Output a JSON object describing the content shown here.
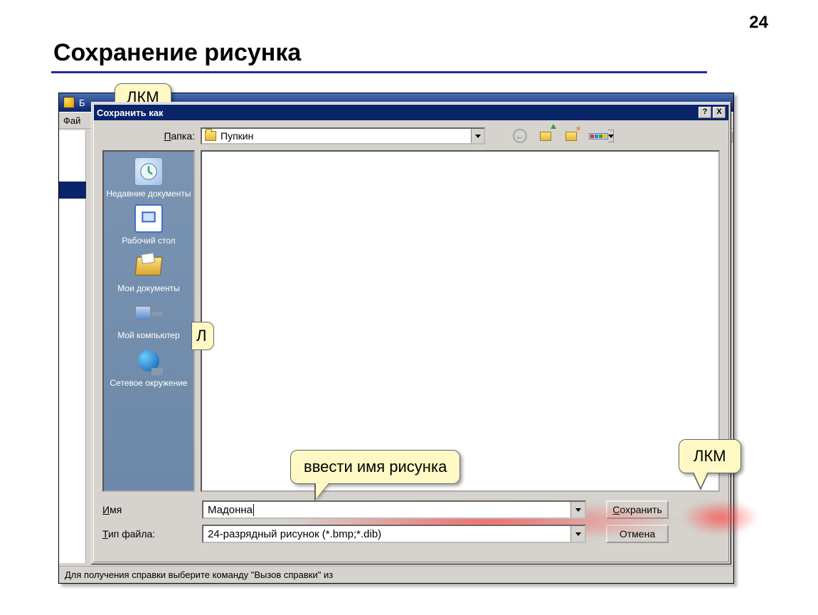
{
  "page": {
    "number": "24",
    "title": "Сохранение рисунка"
  },
  "back_window": {
    "title_prefix": "Б",
    "menu_first": "Фай",
    "status": "Для получения справки выберите команду \"Вызов справки\" из"
  },
  "dialog": {
    "title": "Сохранить как",
    "help_btn": "?",
    "close_btn": "X",
    "folder_label_html": "Папка:",
    "folder_label_prefix": "П",
    "folder_label_rest": "апка:",
    "folder_value": "Пупкин",
    "sidebar": {
      "recent": "Недавние документы",
      "desktop": "Рабочий стол",
      "mydocs": "Мои документы",
      "mycomp": "Мой компьютер",
      "network": "Сетевое окружение"
    },
    "filename_prefix": "И",
    "filename_rest": "мя",
    "filename_value": "Мадонна",
    "filetype_prefix": "Т",
    "filetype_rest": "ип файла:",
    "filetype_value": "24-разрядный рисунок (*.bmp;*.dib)",
    "save_prefix": "С",
    "save_rest": "охранить",
    "cancel": "Отмена"
  },
  "callouts": {
    "top_partial": "ЛКМ",
    "side_partial": "Л",
    "filename": "ввести имя рисунка",
    "save": "ЛКМ"
  }
}
